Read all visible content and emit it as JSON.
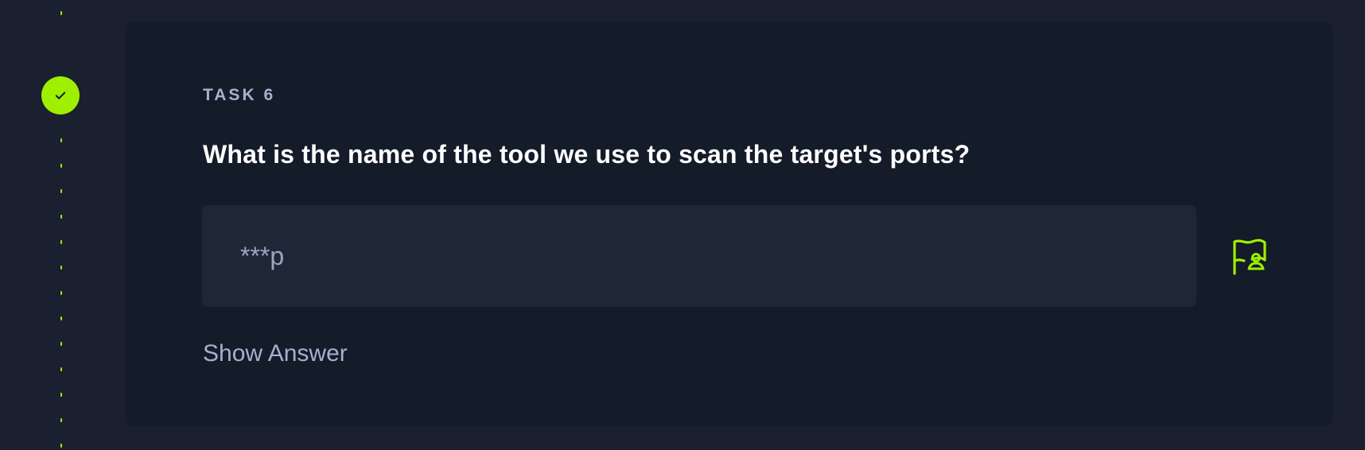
{
  "task": {
    "label": "TASK 6",
    "question": "What is the name of the tool we use to scan the target's ports?",
    "answer_placeholder": "***p",
    "show_answer_label": "Show Answer",
    "completed": true
  },
  "icons": {
    "status": "checkmark-icon",
    "submit": "flag-user-icon"
  },
  "colors": {
    "accent": "#9fef00",
    "background": "#1a2030",
    "card": "#141b29",
    "input": "#1f2636",
    "muted_text": "#a4b1cd",
    "heading_text": "#ffffff"
  }
}
